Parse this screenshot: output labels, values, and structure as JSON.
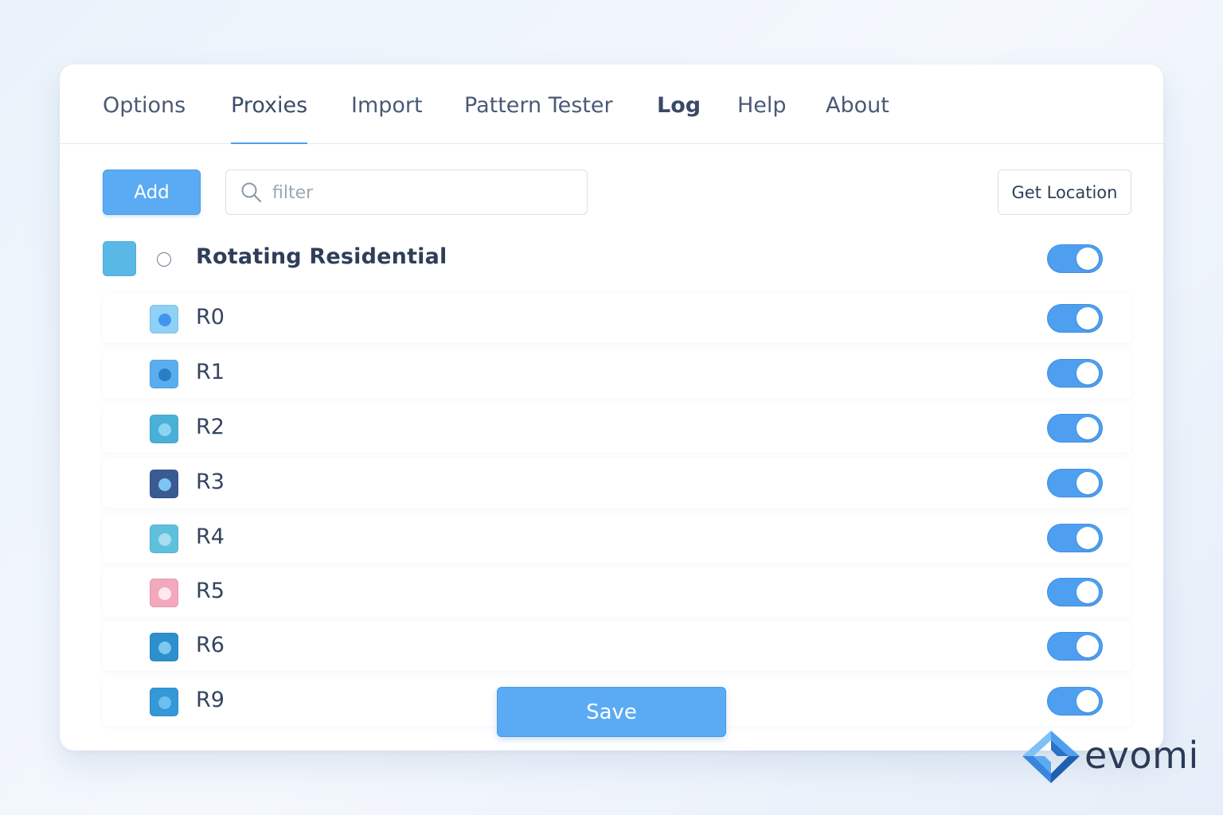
{
  "tabs": [
    {
      "label": "Options",
      "active": false
    },
    {
      "label": "Proxies",
      "active": true
    },
    {
      "label": "Import",
      "active": false
    },
    {
      "label": "Pattern Tester",
      "active": false
    },
    {
      "label": "Log",
      "active": false
    },
    {
      "label": "Help",
      "active": false
    },
    {
      "label": "About",
      "active": false
    }
  ],
  "toolbar": {
    "add_label": "Add",
    "filter_placeholder": "filter",
    "filter_value": "",
    "get_location_label": "Get Location"
  },
  "group": {
    "label": "Rotating Residential",
    "swatch_color": "#5ab8e6",
    "enabled": true
  },
  "proxies": [
    {
      "label": "R0",
      "color": "#8fd0f7",
      "dot_color": "#3f96ee",
      "enabled": true
    },
    {
      "label": "R1",
      "color": "#5aaeee",
      "dot_color": "#2a7fc4",
      "enabled": true
    },
    {
      "label": "R2",
      "color": "#4bb0d8",
      "dot_color": "#8ad6f2",
      "enabled": true
    },
    {
      "label": "R3",
      "color": "#3a5a92",
      "dot_color": "#7cc4f4",
      "enabled": true
    },
    {
      "label": "R4",
      "color": "#5ec0dc",
      "dot_color": "#a8dcf0",
      "enabled": true
    },
    {
      "label": "R5",
      "color": "#f4a8bc",
      "dot_color": "#ffe8ee",
      "enabled": true
    },
    {
      "label": "R6",
      "color": "#2c90cc",
      "dot_color": "#7cc8ee",
      "enabled": true
    },
    {
      "label": "R9",
      "color": "#3598d8",
      "dot_color": "#6cc0ee",
      "enabled": true
    }
  ],
  "save_label": "Save",
  "brand": {
    "name": "evomi",
    "accent": "#4e9ff0"
  }
}
